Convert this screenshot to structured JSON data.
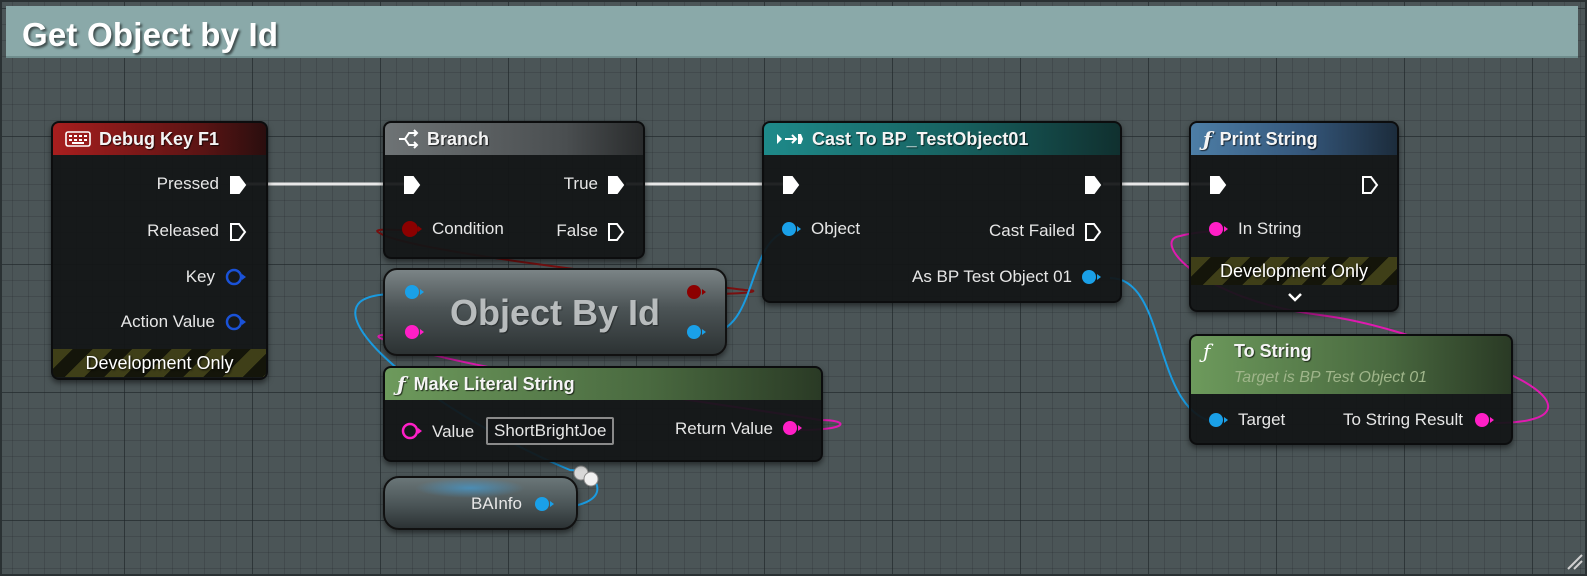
{
  "comment": {
    "title": "Get Object by Id"
  },
  "nodes": {
    "debug_key": {
      "title": "Debug Key F1",
      "pins": {
        "pressed": "Pressed",
        "released": "Released",
        "key": "Key",
        "action_value": "Action Value"
      },
      "footer": "Development Only"
    },
    "branch": {
      "title": "Branch",
      "pins": {
        "condition": "Condition",
        "true": "True",
        "false": "False"
      }
    },
    "object_by_id": {
      "title": "Object By Id"
    },
    "make_literal": {
      "title": "Make Literal String",
      "pins": {
        "value": "Value",
        "return": "Return Value"
      },
      "value": "ShortBrightJoe"
    },
    "cast": {
      "title": "Cast To BP_TestObject01",
      "pins": {
        "object": "Object",
        "cast_failed": "Cast Failed",
        "as_object": "As BP Test Object 01"
      }
    },
    "print_string": {
      "title": "Print String",
      "pins": {
        "in_string": "In String"
      },
      "footer": "Development Only"
    },
    "to_string": {
      "title": "To String",
      "subtitle": "Target is BP Test Object 01",
      "pins": {
        "target": "Target",
        "result": "To String Result"
      }
    },
    "ba_info": {
      "label": "BAInfo"
    }
  },
  "colors": {
    "exec": "#ffffff",
    "bool": "#8c0000",
    "object": "#1aa0e8",
    "string": "#ff1fc6",
    "struct": "#1a52d8",
    "event_header": "#8b1b1b",
    "branch_header": "#5a5e60",
    "cast_header": "#1a7a7a",
    "function_header": "#3f6a8c",
    "pure_header": "#4f7a46"
  }
}
